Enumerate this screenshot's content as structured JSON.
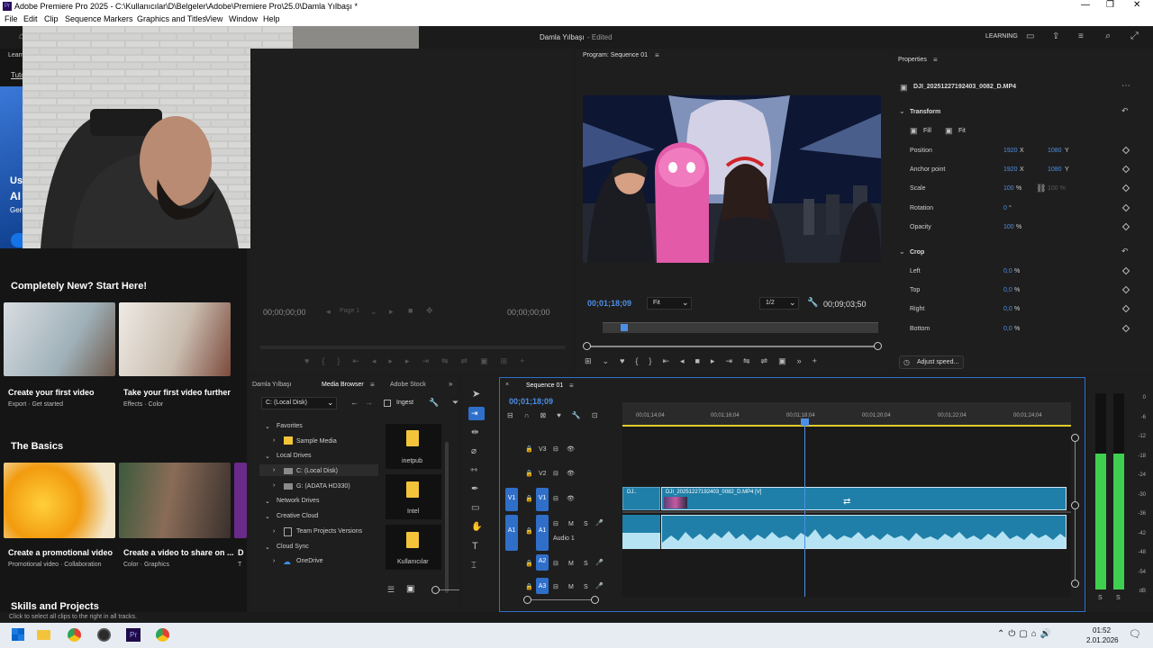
{
  "window": {
    "title": "Adobe Premiere Pro 2025 - C:\\Kullanıcılar\\D\\Belgeler\\Adobe\\Premiere Pro\\25.0\\Damla Yılbaşı *"
  },
  "menu": [
    "File",
    "Edit",
    "Clip",
    "Sequence",
    "Markers",
    "Graphics and Titles",
    "View",
    "Window",
    "Help"
  ],
  "header": {
    "project": "Damla Yılbaşı",
    "status": "- Edited",
    "mode": "LEARNING"
  },
  "learn": {
    "tab_title": "Learn",
    "tab_tutorials": "Tuto",
    "partial_lines": [
      "Us",
      "AI",
      "Gen"
    ],
    "sections": [
      "Completely New? Start Here!",
      "The Basics",
      "Skills and Projects"
    ],
    "cards": [
      {
        "title": "Create your first video",
        "sub": "Export  ·  Get started"
      },
      {
        "title": "Take your first video further",
        "sub": "Effects  ·  Color"
      },
      {
        "title": "Create a promotional video",
        "sub": "Promotional video  ·  Collaboration"
      },
      {
        "title": "Create a video to share on ...",
        "sub": "Color  ·  Graphics"
      },
      {
        "title": "D",
        "sub": "T"
      }
    ]
  },
  "source_monitor": {
    "tc_left": "00;00;00;00",
    "tc_right": "00;00;00;00",
    "page": "Page 1"
  },
  "program_monitor": {
    "title": "Program: Sequence 01",
    "timecode": "00;01;18;09",
    "fit": "Fit",
    "res": "1/2",
    "duration": "00;09;03;50"
  },
  "properties": {
    "title": "Properties",
    "clip": "DJI_20251227192403_0082_D.MP4",
    "transform": {
      "label": "Transform",
      "fill": "Fill",
      "fit": "Fit",
      "rows": [
        {
          "label": "Position",
          "v1": "1920",
          "u1": "X",
          "v2": "1080",
          "u2": "Y"
        },
        {
          "label": "Anchor point",
          "v1": "1920",
          "u1": "X",
          "v2": "1080",
          "u2": "Y"
        },
        {
          "label": "Scale",
          "v1": "100",
          "u1": "%",
          "v2": "100 %",
          "u2": ""
        },
        {
          "label": "Rotation",
          "v1": "0",
          "u1": "°",
          "v2": "",
          "u2": ""
        },
        {
          "label": "Opacity",
          "v1": "100",
          "u1": "%",
          "v2": "",
          "u2": ""
        }
      ]
    },
    "crop": {
      "label": "Crop",
      "rows": [
        {
          "label": "Left",
          "v": "0,0",
          "u": "%"
        },
        {
          "label": "Top",
          "v": "0,0",
          "u": "%"
        },
        {
          "label": "Right",
          "v": "0,0",
          "u": "%"
        },
        {
          "label": "Bottom",
          "v": "0,0",
          "u": "%"
        }
      ]
    },
    "adjust_speed": "Adjust speed..."
  },
  "browser": {
    "tabs": [
      "Damla Yılbaşı",
      "Media Browser",
      "Adobe Stock"
    ],
    "drive": "C: (Local Disk)",
    "ingest": "Ingest",
    "tree": [
      {
        "label": "Favorites",
        "level": 0
      },
      {
        "label": "Sample Media",
        "level": 1
      },
      {
        "label": "Local Drives",
        "level": 0
      },
      {
        "label": "C: (Local Disk)",
        "level": 1
      },
      {
        "label": "G: (ADATA HD330)",
        "level": 1
      },
      {
        "label": "Network Drives",
        "level": 0
      },
      {
        "label": "Creative Cloud",
        "level": 0
      },
      {
        "label": "Team Projects Versions",
        "level": 1
      },
      {
        "label": "Cloud Sync",
        "level": 0
      },
      {
        "label": "OneDrive",
        "level": 1
      }
    ],
    "folders": [
      "inetpub",
      "Intel",
      "Kullanıcılar"
    ]
  },
  "timeline": {
    "title": "Sequence 01",
    "timecode": "00;01;18;09",
    "ruler": [
      "00;01;14;04",
      "00;01;16;04",
      "00;01;18;04",
      "00;01;20;04",
      "00;01;22;04",
      "00;01;24;04"
    ],
    "tracks": {
      "v3": "V3",
      "v2": "V2",
      "v1": "V1",
      "a1": "A1",
      "a2": "A2",
      "a3": "A3",
      "audio1": "Audio 1",
      "m": "M",
      "s": "S"
    },
    "clip_short": "DJ..",
    "clip_name": "DJI_20251227192403_0082_D.MP4 [V]"
  },
  "meter": {
    "scale": [
      "0",
      "-6",
      "-12",
      "-18",
      "-24",
      "-30",
      "-36",
      "-42",
      "-48",
      "-54",
      "dB"
    ],
    "solo": "S",
    "level": 0.72
  },
  "statusbar": "Click to select all clips to the right in all tracks.",
  "taskbar": {
    "time": "01:52",
    "date": "2.01.2026"
  },
  "colors": {
    "accent": "#2f6fc9",
    "clip": "#1f7fa8",
    "meter": "#3fcf4f",
    "timecode": "#4d8fe6"
  }
}
